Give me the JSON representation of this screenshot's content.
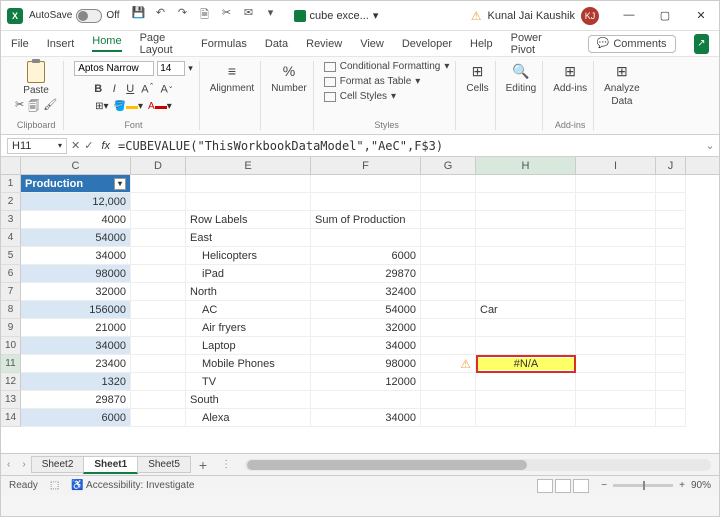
{
  "title": {
    "autosave": "AutoSave",
    "off": "Off",
    "filename": "cube exce...",
    "user": "Kunal Jai Kaushik",
    "initials": "KJ"
  },
  "menu": {
    "file": "File",
    "insert": "Insert",
    "home": "Home",
    "pagelayout": "Page Layout",
    "formulas": "Formulas",
    "data": "Data",
    "review": "Review",
    "view": "View",
    "developer": "Developer",
    "help": "Help",
    "powerpivot": "Power Pivot",
    "comments": "Comments"
  },
  "ribbon": {
    "paste": "Paste",
    "clipboard": "Clipboard",
    "font_name": "Aptos Narrow",
    "font_size": "14",
    "font": "Font",
    "alignment": "Alignment",
    "number": "Number",
    "pct": "%",
    "condfmt": "Conditional Formatting",
    "fmttable": "Format as Table",
    "cellstyles": "Cell Styles",
    "styles": "Styles",
    "cells": "Cells",
    "editing": "Editing",
    "addins": "Add-ins",
    "analyze": "Analyze",
    "data": "Data",
    "addins_grp": "Add-ins"
  },
  "fbar": {
    "name": "H11",
    "formula": "=CUBEVALUE(\"ThisWorkbookDataModel\",\"AeC\",F$3)"
  },
  "cols": {
    "C": "C",
    "D": "D",
    "E": "E",
    "F": "F",
    "G": "G",
    "H": "H",
    "I": "I",
    "J": "J"
  },
  "rows": {
    "r1": {
      "n": "1",
      "C": "Production"
    },
    "r2": {
      "n": "2",
      "C": "12,000"
    },
    "r3": {
      "n": "3",
      "C": "4000",
      "E": "Row Labels",
      "F": "Sum of Production"
    },
    "r4": {
      "n": "4",
      "C": "54000",
      "E": "East"
    },
    "r5": {
      "n": "5",
      "C": "34000",
      "E": "Helicopters",
      "F": "6000"
    },
    "r6": {
      "n": "6",
      "C": "98000",
      "E": "iPad",
      "F": "29870"
    },
    "r7": {
      "n": "7",
      "C": "32000",
      "E": "North",
      "F": "32400"
    },
    "r8": {
      "n": "8",
      "C": "156000",
      "E": "AC",
      "F": "54000",
      "H": "Car"
    },
    "r9": {
      "n": "9",
      "C": "21000",
      "E": "Air fryers",
      "F": "32000"
    },
    "r10": {
      "n": "10",
      "C": "34000",
      "E": "Laptop",
      "F": "34000"
    },
    "r11": {
      "n": "11",
      "C": "23400",
      "E": "Mobile Phones",
      "F": "98000",
      "H": "#N/A"
    },
    "r12": {
      "n": "12",
      "C": "1320",
      "E": "TV",
      "F": "12000"
    },
    "r13": {
      "n": "13",
      "C": "29870",
      "E": "South"
    },
    "r14": {
      "n": "14",
      "C": "6000",
      "E": "Alexa",
      "F": "34000"
    }
  },
  "tabs": {
    "s2": "Sheet2",
    "s1": "Sheet1",
    "s5": "Sheet5"
  },
  "status": {
    "ready": "Ready",
    "access": "Accessibility: Investigate",
    "zoom": "90%"
  }
}
